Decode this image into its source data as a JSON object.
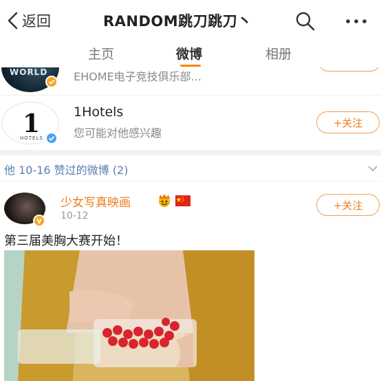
{
  "header": {
    "back_label": "返回",
    "title": "RANDOM跳刀跳刀丶",
    "back_icon": "chevron-left-icon",
    "search_icon": "search-icon",
    "more_icon": "more-icon"
  },
  "tabs": [
    {
      "label": "主页",
      "active": false
    },
    {
      "label": "微博",
      "active": true
    },
    {
      "label": "相册",
      "active": false
    }
  ],
  "accounts": [
    {
      "name": "EHOME电子竞技俱乐部...",
      "avatar_text": "WORLD",
      "verified_color": "#f5a623"
    },
    {
      "name": "1Hotels",
      "subtitle": "您可能对他感兴趣",
      "logo_mark": "1",
      "logo_text": "HOTELS",
      "verified_color": "#4aa3ea",
      "follow_label": "+关注"
    }
  ],
  "section": {
    "title": "他 10-16 赞过的微博 (2)",
    "toggle_icon": "chevron-down-icon"
  },
  "post": {
    "author": "少女写真映画",
    "time": "10-12",
    "text": "第三届美胸大赛开始！",
    "follow_label": "+关注",
    "badges": [
      "reaction-emoji-icon",
      "china-flag-icon"
    ]
  },
  "colors": {
    "accent": "#ff8200",
    "link": "#5b7db1",
    "follow_border": "#f29b4b",
    "author_name": "#f07c1b"
  }
}
